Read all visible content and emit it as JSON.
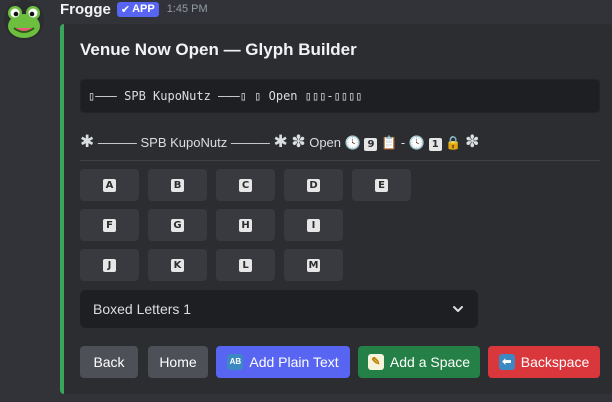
{
  "author": {
    "username": "Frogge",
    "badge": "APP",
    "timestamp": "1:45 PM"
  },
  "embed": {
    "title": "Venue Now Open — Glyph Builder",
    "code_text": "▯——— SPB KupoNutz ———▯ ▯ Open ▯▯▯-▯▯▯▯",
    "glyph_text": "——— SPB KupoNutz ———",
    "glyph_open": "Open",
    "accent_color": "#3ba55c"
  },
  "letter_buttons": [
    "A",
    "B",
    "C",
    "D",
    "E",
    "F",
    "G",
    "H",
    "I",
    "J",
    "K",
    "L",
    "M"
  ],
  "select": {
    "value": "Boxed Letters 1"
  },
  "actions": {
    "back": "Back",
    "home": "Home",
    "add_plain_text": "Add Plain Text",
    "add_plain_text_icon": "🔤",
    "add_space": "Add a Space",
    "add_space_icon": "📝",
    "backspace": "Backspace",
    "backspace_icon": "⬅"
  }
}
